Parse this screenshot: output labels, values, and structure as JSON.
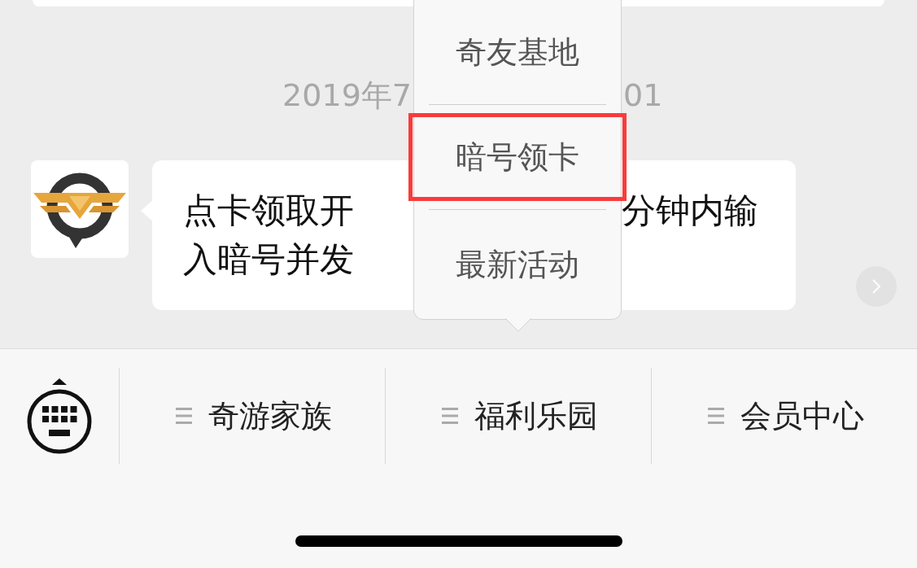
{
  "chat": {
    "timestamp": {
      "text_before_popup": "2019年7",
      "text_after_popup": "01"
    },
    "message": {
      "lines_before_popup": [
        "点卡领取开",
        "入暗号并发"
      ],
      "lines_after_popup": [
        "分钟内输"
      ]
    }
  },
  "popup_menu": {
    "items": [
      {
        "label": "奇友基地",
        "selected": false
      },
      {
        "label": "暗号领卡",
        "selected": true
      },
      {
        "label": "最新活动",
        "selected": false
      }
    ]
  },
  "bottom_menu": {
    "items": [
      {
        "label": "奇游家族"
      },
      {
        "label": "福利乐园"
      },
      {
        "label": "会员中心"
      }
    ]
  }
}
